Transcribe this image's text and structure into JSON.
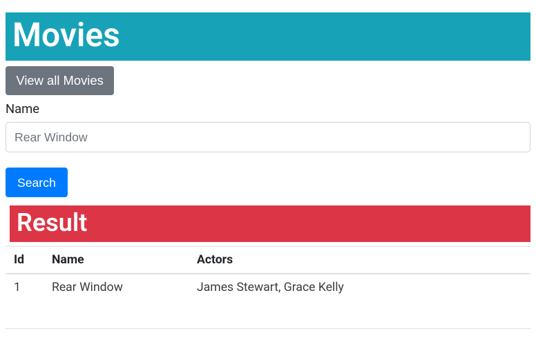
{
  "header": {
    "title": "Movies"
  },
  "buttons": {
    "viewAll": "View all Movies",
    "search": "Search"
  },
  "form": {
    "nameLabel": "Name",
    "nameValue": "Rear Window"
  },
  "result": {
    "title": "Result",
    "columns": {
      "id": "Id",
      "name": "Name",
      "actors": "Actors"
    },
    "rows": [
      {
        "id": "1",
        "name": "Rear Window",
        "actors": "James Stewart, Grace Kelly"
      }
    ]
  }
}
